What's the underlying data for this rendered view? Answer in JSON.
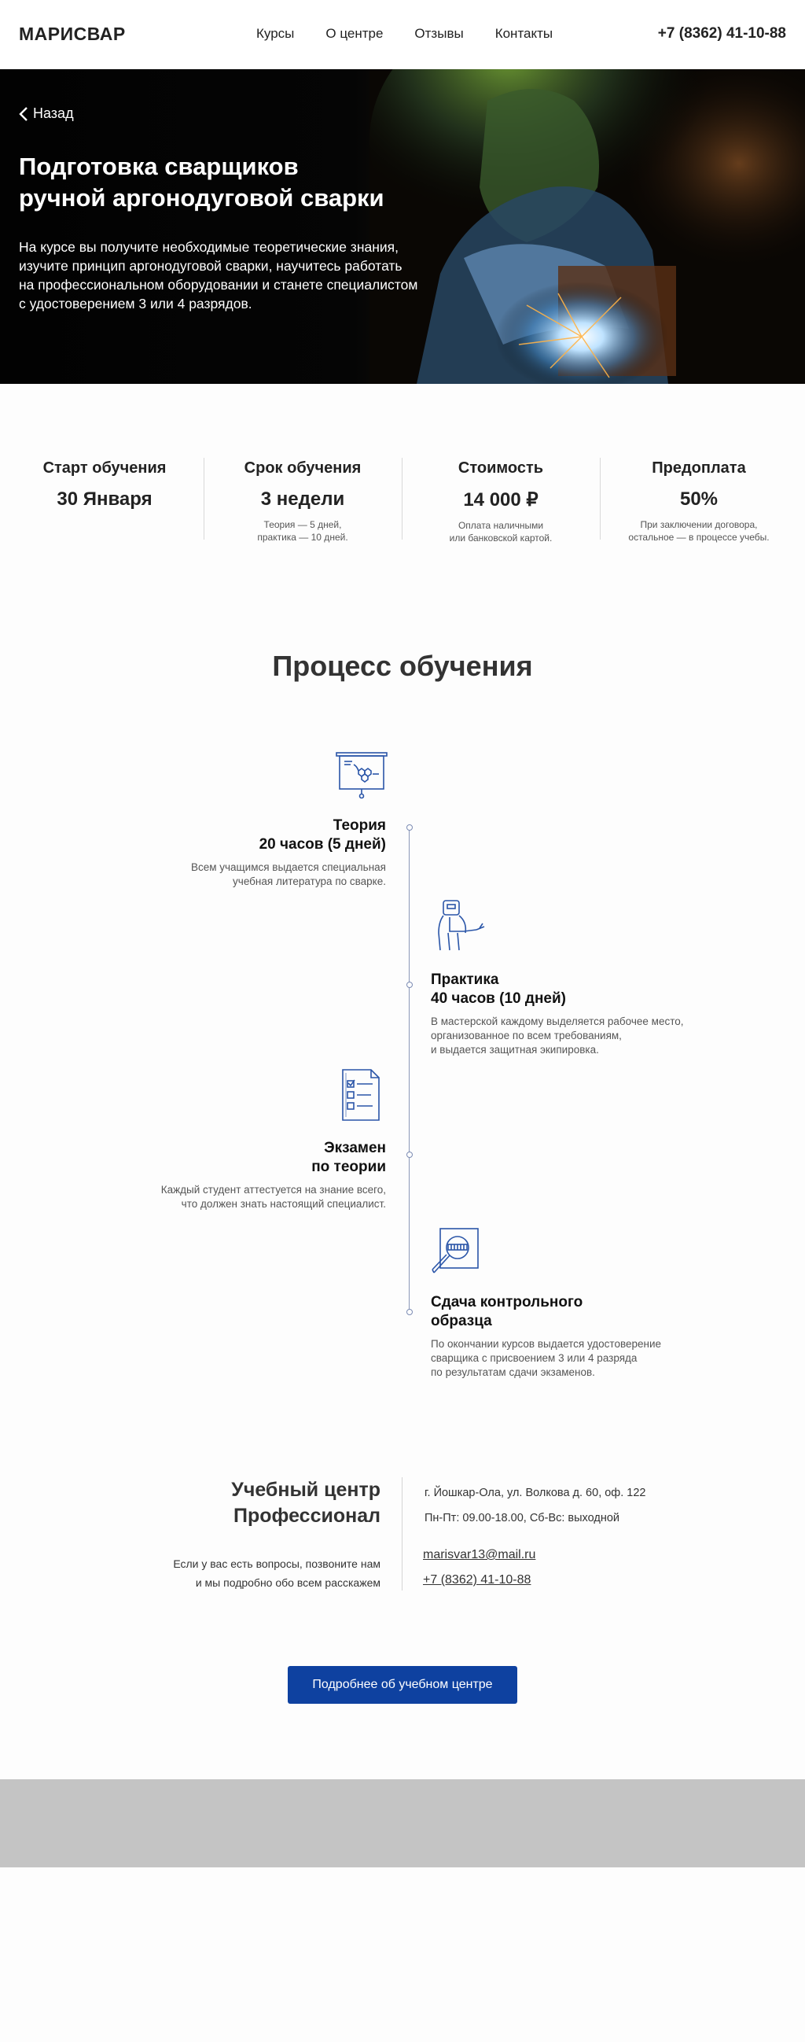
{
  "header": {
    "logo": "МАРИСВАР",
    "nav": [
      "Курсы",
      "О центре",
      "Отзывы",
      "Контакты"
    ],
    "phone": "+7 (8362) 41-10-88"
  },
  "hero": {
    "back_label": "Назад",
    "title_line1": "Подготовка сварщиков",
    "title_line2": "ручной аргонодуговой сварки",
    "text_lines": [
      "На курсе вы получите необходимые теоретические знания,",
      "изучите принцип аргонодуговой сварки, научитесь работать",
      "на профессиональном оборудовании и станете специалистом",
      "с удостоверением 3 или 4 разрядов."
    ]
  },
  "facts": [
    {
      "title": "Старт обучения",
      "value": "30 Января",
      "note1": "",
      "note2": ""
    },
    {
      "title": "Срок обучения",
      "value": "3 недели",
      "note1": "Теория — 5 дней,",
      "note2": "практика — 10 дней."
    },
    {
      "title": "Стоимость",
      "value": "14 000 ₽",
      "note1": "Оплата наличными",
      "note2": "или банковской картой."
    },
    {
      "title": "Предоплата",
      "value": "50%",
      "note1": "При заключении договора,",
      "note2": "остальное — в процессе учебы."
    }
  ],
  "process": {
    "title": "Процесс обучения",
    "steps": [
      {
        "icon": "presentation-board-icon",
        "title1": "Теория",
        "title2": "20 часов (5 дней)",
        "desc": [
          "Всем учащимся выдается специальная",
          "учебная литература по сварке."
        ]
      },
      {
        "icon": "welder-icon",
        "title1": "Практика",
        "title2": "40 часов (10 дней)",
        "desc": [
          "В мастерской каждому выделяется рабочее место,",
          "организованное по всем требованиям,",
          "и выдается защитная экипировка."
        ]
      },
      {
        "icon": "checklist-document-icon",
        "title1": "Экзамен",
        "title2": "по теории",
        "desc": [
          "Каждый студент аттестуется на знание всего,",
          "что должен знать настоящий специалист."
        ]
      },
      {
        "icon": "weld-inspection-icon",
        "title1": "Сдача контрольного",
        "title2": "образца",
        "desc": [
          "По окончании курсов выдается удостоверение",
          "сварщика с присвоением 3 или 4 разряда",
          "по результатам сдачи экзаменов."
        ]
      }
    ]
  },
  "contacts": {
    "title1": "Учебный центр",
    "title2": "Профессионал",
    "sub1": "Если у вас есть вопросы, позвоните нам",
    "sub2": "и мы подробно обо всем расскажем",
    "address": "г. Йошкар-Ола, ул. Волкова д. 60, оф. 122",
    "hours": "Пн-Пт: 09.00-18.00, Сб-Вс: выходной",
    "email": "marisvar13@mail.ru",
    "phone": "+7 (8362) 41-10-88"
  },
  "cta_label": "Подробнее об учебном центре",
  "colors": {
    "accent": "#0e41a0",
    "icon": "#2a55a8",
    "footer": "#c4c4c4"
  }
}
